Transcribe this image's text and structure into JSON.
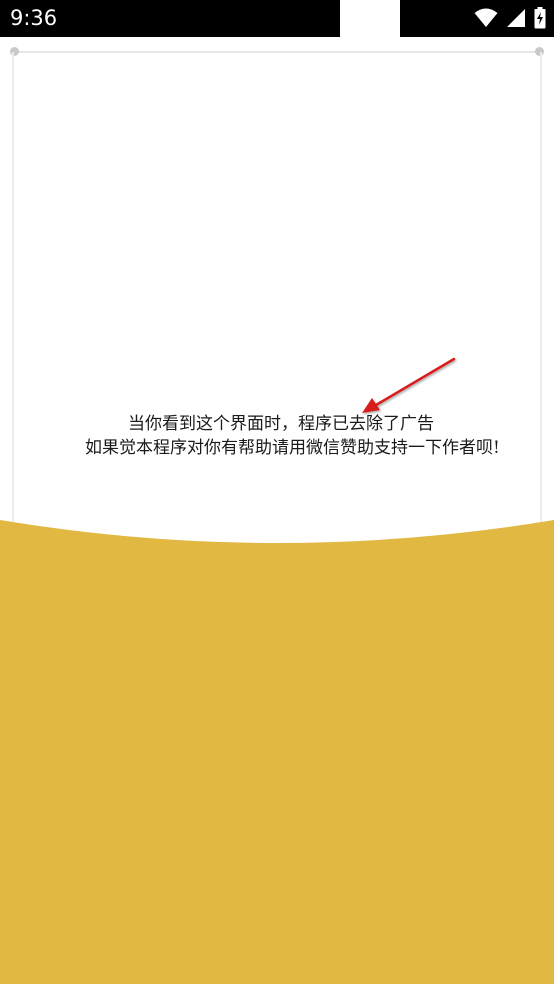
{
  "status_bar": {
    "time": "9:36",
    "icons": [
      "wifi-icon",
      "signal-icon",
      "battery-charging-icon"
    ]
  },
  "message": {
    "line1": "当你看到这个界面时，程序已去除了广告",
    "line2": "如果觉本程序对你有帮助请用微信赞助支持一下作者呗!"
  },
  "colors": {
    "status_bar_bg": "#000000",
    "accent_wave": "#e0b842",
    "arrow": "#d81b1b",
    "text": "#1a1a1a"
  }
}
